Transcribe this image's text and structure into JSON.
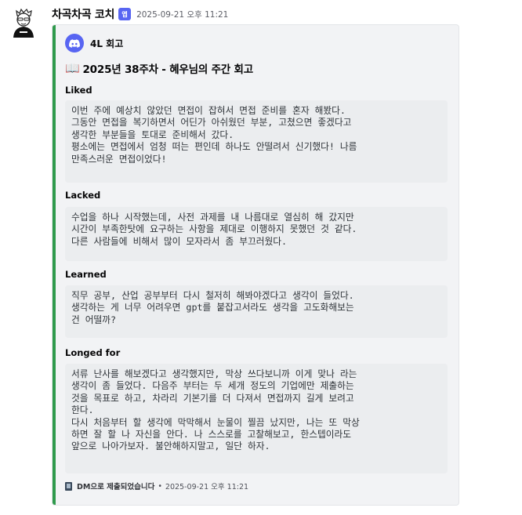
{
  "message": {
    "username": "차곡차곡 코치",
    "app_badge": "앱",
    "timestamp": "2025-09-21 오후 11:21"
  },
  "embed": {
    "accent_color": "#2f9a4c",
    "author": {
      "icon": "discord-icon",
      "name": "4L 회고"
    },
    "title_icon": "open-book-icon",
    "title": "2025년 38주차 - 혜우님의 주간 회고",
    "fields": [
      {
        "name": "Liked",
        "value": "이번 주에 예상치 않았던 면접이 잡혀서 면접 준비를 혼자 해봤다.\n그동안 면접을 복기하면서 어딘가 아쉬웠던 부분, 고쳤으면 좋겠다고\n생각한 부분들을 토대로 준비해서 갔다.\n평소에는 면접에서 엄청 떠는 편인데 하나도 안떨려서 신기했다! 나름\n만족스러운 면접이었다!"
      },
      {
        "name": "Lacked",
        "value": "수업을 하나 시작했는데, 사전 과제를 내 나름대로 열심히 해 갔지만\n시간이 부족한탓에 요구하는 사항을 제대로 이행하지 못했던 것 같다.\n다른 사람들에 비해서 많이 모자라서 좀 부끄러웠다."
      },
      {
        "name": "Learned",
        "value": "직무 공부, 산업 공부부터 다시 철저히 해봐야겠다고 생각이 들었다.\n생각하는 게 너무 어려우면 gpt를 붙잡고서라도 생각을 고도화해보는\n건 어떨까?"
      },
      {
        "name": "Longed for",
        "value": "서류 난사를 해보겠다고 생각했지만, 막상 쓰다보니까 이게 맞나 라는\n생각이 좀 들었다. 다음주 부터는 두 세개 정도의 기업에만 제출하는\n것을 목표로 하고, 차라리 기본기를 더 다져서 면접까지 길게 보려고\n한다.\n다시 처음부터 할 생각에 막막해서 눈물이 찔끔 났지만, 나는 또 막상\n하면 잘 할 나 자신을 안다. 나 스스로를 고찰해보고, 한스텝이라도\n앞으로 나아가보자. 불안해하지말고, 일단 하자."
      }
    ],
    "footer": {
      "icon": "page-icon",
      "text": "DM으로 제출되었습니다",
      "separator": "•",
      "timestamp": "2025-09-21 오후 11:21"
    }
  }
}
